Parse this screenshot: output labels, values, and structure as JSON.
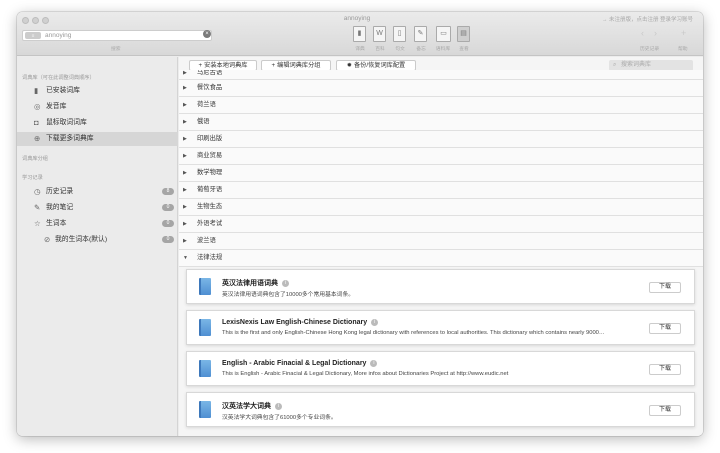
{
  "window": {
    "title": "annoying",
    "right_text": "→ 未注册版，点击注册   登录学习账号"
  },
  "toolbar": {
    "search_value": "annoying",
    "search_label": "搜索",
    "tools": [
      {
        "label": "译典",
        "icon": "book-icon",
        "glyph": "▮"
      },
      {
        "label": "百科",
        "icon": "word-icon",
        "glyph": "W"
      },
      {
        "label": "句文",
        "icon": "doc-icon",
        "glyph": "▯"
      },
      {
        "label": "备忘",
        "icon": "note-icon",
        "glyph": "✎"
      },
      {
        "label": "语料库",
        "icon": "corpus-icon",
        "glyph": "▭"
      },
      {
        "label": "查看",
        "icon": "view-icon",
        "glyph": "▤"
      }
    ],
    "nav_label": "历史记录",
    "help_label": "帮助",
    "add_glyph": "+"
  },
  "sidebar": {
    "section1": "词典库（可在此调整词典顺序）",
    "items1": [
      {
        "label": "已安装词库",
        "icon": "book-icon",
        "glyph": "▮"
      },
      {
        "label": "发音库",
        "icon": "speaker-icon",
        "glyph": "◎"
      },
      {
        "label": "鼠标取词词库",
        "icon": "mouse-icon",
        "glyph": "◘"
      },
      {
        "label": "下载更多词典库",
        "icon": "download-icon",
        "glyph": "⊕"
      }
    ],
    "section2": "词典库分组",
    "section3": "学习记录",
    "items2": [
      {
        "label": "历史记录",
        "icon": "clock-icon",
        "glyph": "◷",
        "badge": "8"
      },
      {
        "label": "我的笔记",
        "icon": "pencil-icon",
        "glyph": "✎",
        "badge": "0"
      },
      {
        "label": "生词本",
        "icon": "star-icon",
        "glyph": "☆",
        "badge": "0"
      },
      {
        "label": "我的生词本(默认)",
        "icon": "tag-icon",
        "glyph": "⊘",
        "badge": "0"
      }
    ]
  },
  "main": {
    "buttons": [
      {
        "label": "安装本地词典库",
        "glyph": "+"
      },
      {
        "label": "编辑词典库分组",
        "glyph": "+"
      },
      {
        "label": "备份/恢复词库配置",
        "glyph": "✹"
      }
    ],
    "search_placeholder": "搜索词典库",
    "categories": [
      {
        "label": "马尼古语",
        "arrow": "▶"
      },
      {
        "label": "餐饮食品",
        "arrow": "▶"
      },
      {
        "label": "荷兰语",
        "arrow": "▶"
      },
      {
        "label": "俄语",
        "arrow": "▶"
      },
      {
        "label": "印刷出版",
        "arrow": "▶"
      },
      {
        "label": "商业贸易",
        "arrow": "▶"
      },
      {
        "label": "数学物理",
        "arrow": "▶"
      },
      {
        "label": "葡萄牙语",
        "arrow": "▶"
      },
      {
        "label": "生物生态",
        "arrow": "▶"
      },
      {
        "label": "外语考试",
        "arrow": "▶"
      },
      {
        "label": "波兰语",
        "arrow": "▶"
      },
      {
        "label": "法律法规",
        "arrow": "▼"
      }
    ],
    "dictionaries": [
      {
        "title": "英汉法律用语词典",
        "desc": "英汉法律用语词典包含了10000多个常用基本词条。",
        "button": "下载"
      },
      {
        "title": "LexisNexis Law English-Chinese Dictionary",
        "desc": "This is the first and only English-Chinese Hong Kong legal dictionary with references to local authorities. This dictionary which contains nearly 9000…",
        "button": "下载"
      },
      {
        "title": "English - Arabic Finacial & Legal Dictionary",
        "desc": "This is English - Arabic Finacial & Legal Dictionary,  More infos about  Dictionaries Project at http://www.eudic.net",
        "button": "下载"
      },
      {
        "title": "汉英法学大词典",
        "desc": "汉英法学大词典包含了61000多个专业词条。",
        "button": "下载"
      }
    ],
    "info_glyph": "i"
  }
}
